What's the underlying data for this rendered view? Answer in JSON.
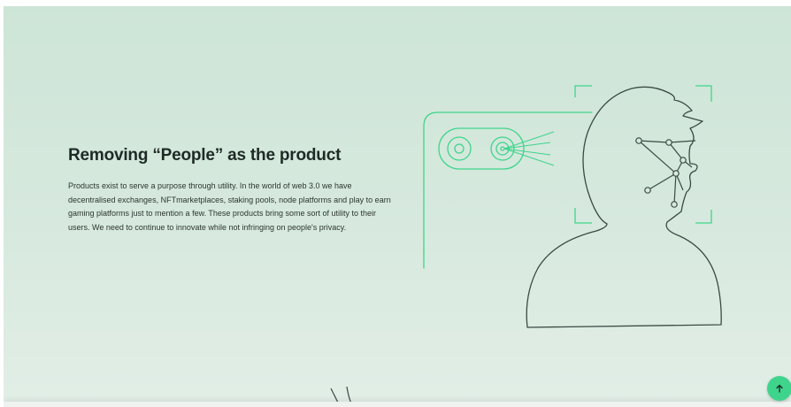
{
  "section": {
    "heading": "Removing “People” as the product",
    "body": "Products exist to serve a purpose through utility. In the world of web 3.0 we have decentralised exchanges, NFTmarketplaces, staking pools, node platforms and play to earn gaming platforms just to mention a few. These products bring some sort of utility to their users. We need to continue to innovate while not infringing on people's privacy."
  },
  "illustration": {
    "icon": "face-recognition-scan-illustration",
    "accent_color": "#3fd48c",
    "line_color": "#3a4a43"
  },
  "scroll_top": {
    "icon": "arrow-up-icon",
    "color": "#3fd48c"
  }
}
